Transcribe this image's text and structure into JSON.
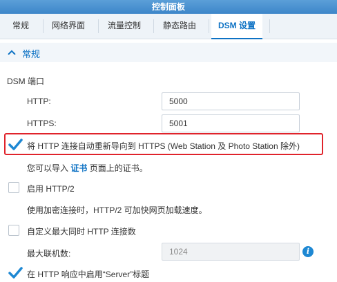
{
  "window": {
    "title": "控制面板"
  },
  "tabs": [
    {
      "label": "常规"
    },
    {
      "label": "网络界面"
    },
    {
      "label": "流量控制"
    },
    {
      "label": "静态路由"
    },
    {
      "label": "DSM 设置",
      "active": true
    }
  ],
  "section": {
    "title": "常规",
    "chevron_icon": "chevron-up-icon"
  },
  "dsm_port": {
    "heading": "DSM 端口",
    "http_label": "HTTP:",
    "http_value": "5000",
    "https_label": "HTTPS:",
    "https_value": "5001"
  },
  "redirect": {
    "checked": true,
    "label": "将 HTTP 连接自动重新导向到 HTTPS (Web Station 及 Photo Station 除外)",
    "highlight_color": "#e0232b"
  },
  "cert_note": {
    "prefix": "您可以导入",
    "link": "证书",
    "suffix": "页面上的证书。"
  },
  "http2": {
    "checked": false,
    "label": "启用 HTTP/2",
    "note": "使用加密连接时，HTTP/2 可加快网页加载速度。"
  },
  "max_conn": {
    "checked": false,
    "label": "自定义最大同时 HTTP 连接数",
    "field_label": "最大联机数:",
    "field_value": "1024",
    "info_icon": "info-icon"
  },
  "server_header": {
    "checked": true,
    "label": "在 HTTP 响应中启用“Server”标题"
  },
  "colors": {
    "accent": "#0d72c4",
    "check": "#1e88d3"
  }
}
